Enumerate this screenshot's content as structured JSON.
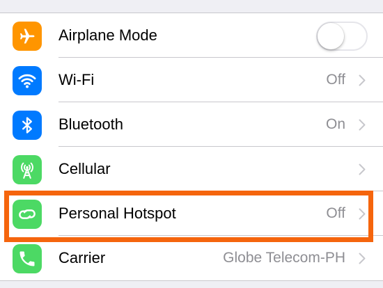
{
  "colors": {
    "airplane": "#ff9500",
    "wifi": "#007aff",
    "bluetooth": "#007aff",
    "cellular": "#4cd964",
    "hotspot": "#4cd964",
    "carrier": "#4cd964",
    "highlight": "#f5650d",
    "value_text": "#8e8e93"
  },
  "settings": {
    "rows": [
      {
        "label": "Airplane Mode",
        "icon": "airplane-icon",
        "control": "toggle",
        "toggle_on": false
      },
      {
        "label": "Wi-Fi",
        "value": "Off",
        "icon": "wifi-icon"
      },
      {
        "label": "Bluetooth",
        "value": "On",
        "icon": "bluetooth-icon"
      },
      {
        "label": "Cellular",
        "value": "",
        "icon": "cellular-icon"
      },
      {
        "label": "Personal Hotspot",
        "value": "Off",
        "icon": "hotspot-icon",
        "highlighted": true
      },
      {
        "label": "Carrier",
        "value": "Globe Telecom-PH",
        "icon": "phone-icon"
      }
    ]
  }
}
